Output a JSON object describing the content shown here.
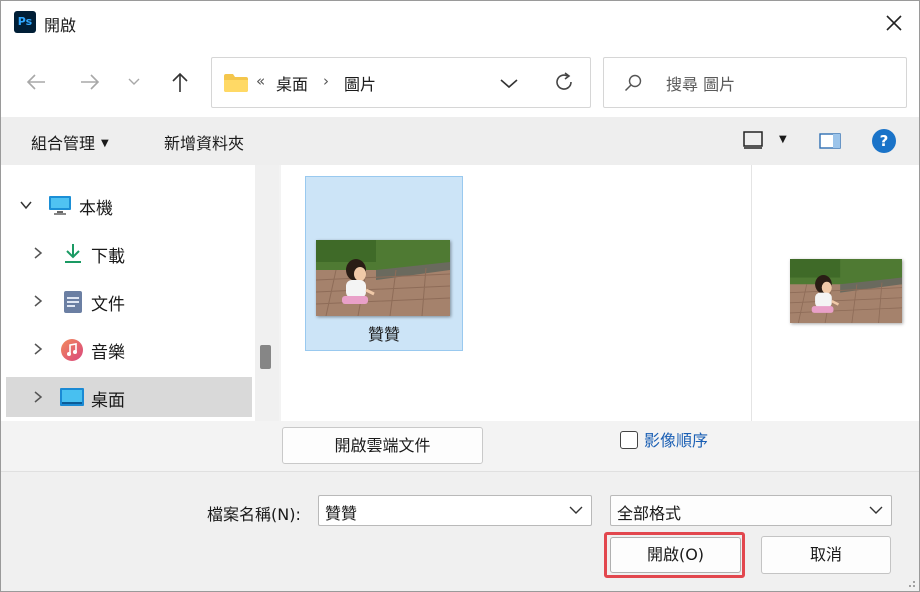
{
  "window": {
    "title": "開啟",
    "app_icon_text": "Ps"
  },
  "nav": {
    "breadcrumb_prefix": "«",
    "breadcrumb": [
      "桌面",
      "圖片"
    ],
    "search_placeholder": "搜尋 圖片"
  },
  "commands": {
    "organize": "組合管理",
    "new_folder": "新增資料夾"
  },
  "tree": {
    "items": [
      {
        "label": "本機",
        "icon": "computer-icon"
      },
      {
        "label": "下載",
        "icon": "download-icon"
      },
      {
        "label": "文件",
        "icon": "document-icon"
      },
      {
        "label": "音樂",
        "icon": "music-icon"
      },
      {
        "label": "桌面",
        "icon": "desktop-icon",
        "selected": true
      }
    ]
  },
  "files": [
    {
      "name": "贊贊",
      "selected": true
    }
  ],
  "lower": {
    "cloud_button": "開啟雲端文件",
    "image_sequence_label": "影像順序",
    "image_sequence_checked": false
  },
  "bottom": {
    "filename_label": "檔案名稱(N):",
    "filename_value": "贊贊",
    "filetype_value": "全部格式",
    "open_button": "開啟(O)",
    "cancel_button": "取消"
  },
  "colors": {
    "selection": "#cce4f7",
    "highlight_border": "#e2474e",
    "help_blue": "#1a73c8",
    "link_blue": "#1a5fb4"
  }
}
